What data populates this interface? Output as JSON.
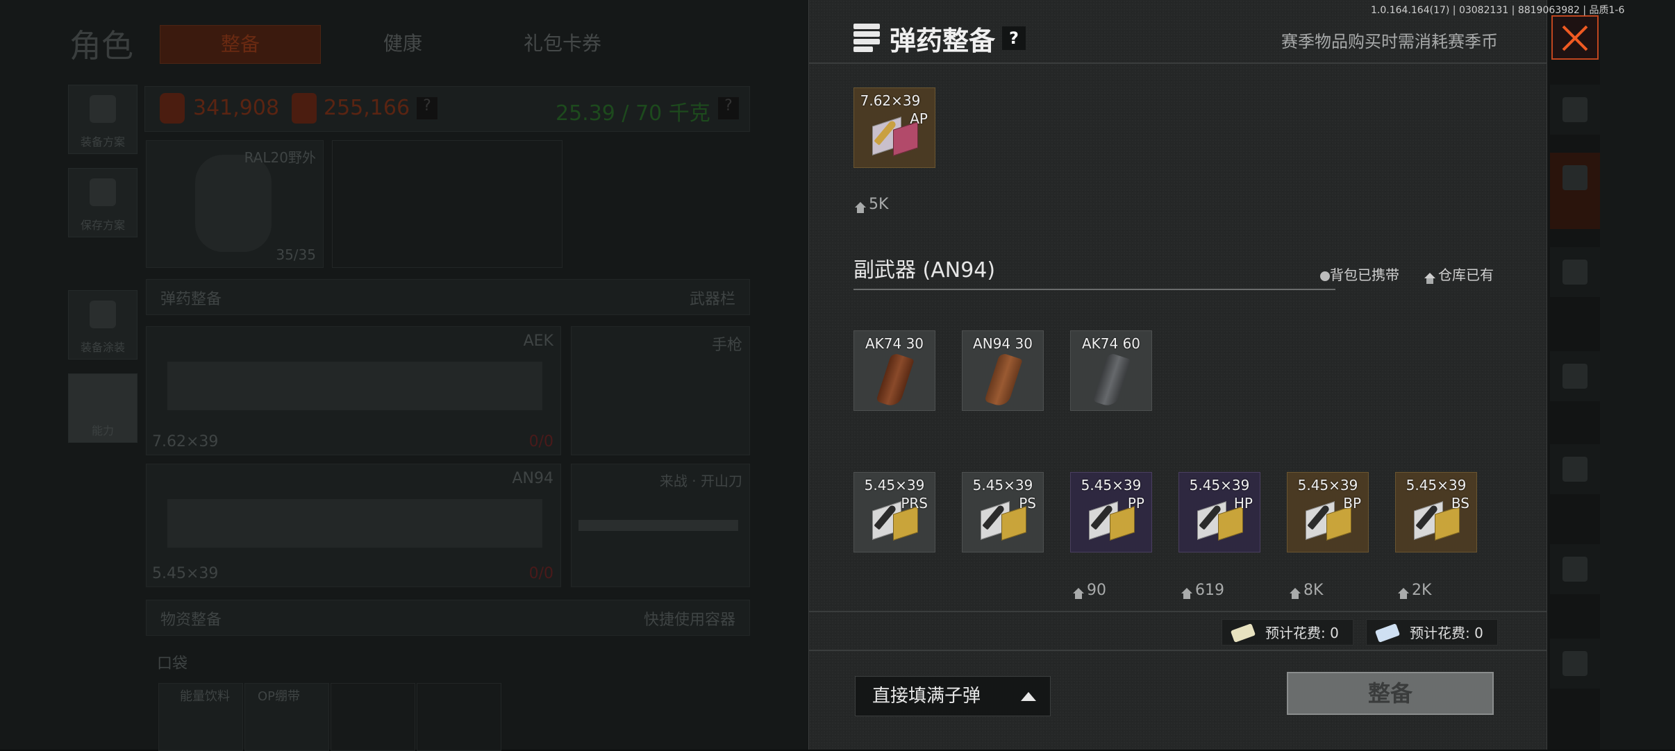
{
  "version_info": "1.0.164.164(17) | 03082131 | 8819063982 | 品质1-6",
  "background": {
    "title": "角色",
    "tabs": [
      "整备",
      "健康",
      "礼包卡券"
    ],
    "side_buttons": [
      "装备方案",
      "保存方案",
      "装备涂装",
      "能力"
    ],
    "currency1": "341,908",
    "currency2": "255,166",
    "weight": "25.39 / 70 千克",
    "helmet_name": "RAL20野外",
    "helmet_durability": "35/35",
    "ammo_section": "弹药整备",
    "weapon_slot": "武器栏",
    "weapons": [
      {
        "name": "AEK",
        "caliber": "7.62×39",
        "ammo": "0/0"
      },
      {
        "name": "AN94",
        "caliber": "5.45×39",
        "ammo": "0/0"
      }
    ],
    "pistol_label": "手枪",
    "melee_label": "来战 · 开山刀",
    "supply_section": "物资整备",
    "quick_container": "快捷使用容器",
    "pocket": "口袋",
    "pocket_items": [
      "能量饮料",
      "OP绷带"
    ]
  },
  "modal": {
    "title": "弹药整备",
    "help": "?",
    "note": "赛季物品购买时需消耗赛季币",
    "primary_ammo": {
      "caliber": "7.62×39",
      "type": "AP",
      "stock": "5K"
    },
    "secondary_title": "副武器 (AN94)",
    "legend_backpack": "背包已携带",
    "legend_warehouse": "仓库已有",
    "magazines": [
      {
        "label": "AK74 30",
        "style": "ak74"
      },
      {
        "label": "AN94 30",
        "style": "an94"
      },
      {
        "label": "AK74 60",
        "style": "ak60"
      }
    ],
    "ammo": [
      {
        "caliber": "5.45×39",
        "type": "PRS",
        "stock": "",
        "tier": "gray"
      },
      {
        "caliber": "5.45×39",
        "type": "PS",
        "stock": "",
        "tier": "gray"
      },
      {
        "caliber": "5.45×39",
        "type": "PP",
        "stock": "90",
        "tier": "purple"
      },
      {
        "caliber": "5.45×39",
        "type": "HP",
        "stock": "619",
        "tier": "purple"
      },
      {
        "caliber": "5.45×39",
        "type": "BP",
        "stock": "8K",
        "tier": "gold"
      },
      {
        "caliber": "5.45×39",
        "type": "BS",
        "stock": "2K",
        "tier": "gold"
      }
    ],
    "cost1": "预计花费: 0",
    "cost2": "预计花费: 0",
    "fill_button": "直接填满子弹",
    "equip_button": "整备"
  }
}
